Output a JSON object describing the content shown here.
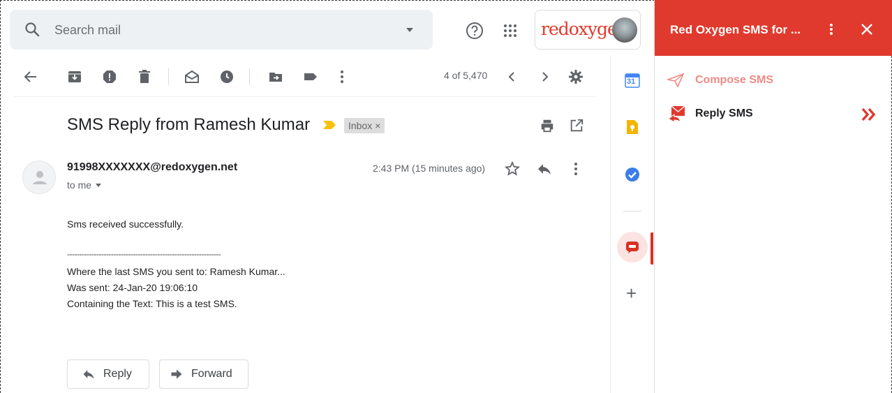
{
  "search": {
    "placeholder": "Search mail"
  },
  "brand": {
    "logo_text": "redoxygen"
  },
  "toolbar": {
    "pager": "4 of 5,470"
  },
  "email": {
    "subject": "SMS Reply from Ramesh Kumar",
    "label": "Inbox",
    "label_close": "×",
    "sender": "91998XXXXXXX@redoxygen.net",
    "to": "to me",
    "time": "2:43 PM (15 minutes ago)",
    "body_line1": "Sms received successfully.",
    "divider": "---------------------------------------------------------------",
    "body_line2": "Where the last SMS you sent to: Ramesh Kumar...",
    "body_line3": "Was sent: 24-Jan-20 19:06:10",
    "body_line4": "Containing the Text: This is a test SMS."
  },
  "actions": {
    "reply": "Reply",
    "forward": "Forward"
  },
  "rail": {
    "calendar_day": "31",
    "add": "+"
  },
  "panel": {
    "title": "Red Oxygen SMS for ...",
    "compose": "Compose SMS",
    "reply": "Reply SMS",
    "accent": "#e03a2e",
    "muted_accent": "#ee8b85"
  }
}
